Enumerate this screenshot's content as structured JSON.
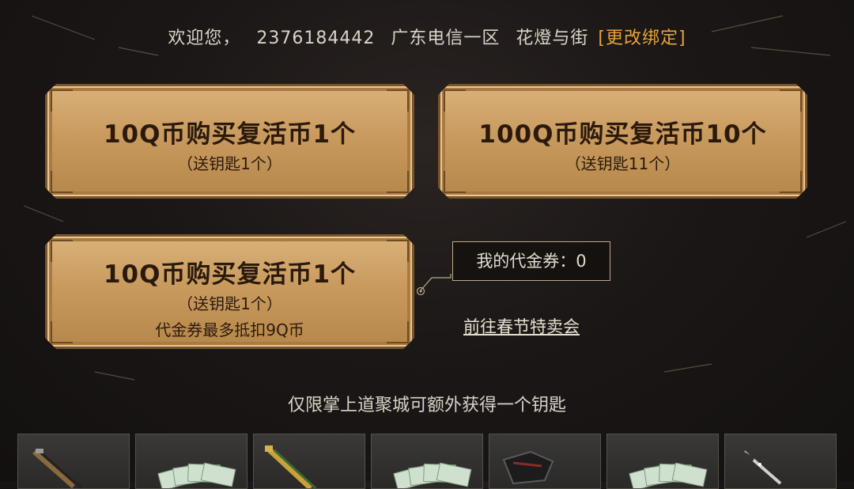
{
  "header": {
    "welcome_text": "欢迎您，",
    "account_id": "2376184442",
    "server": "广东电信一区",
    "nickname": "花燈与街",
    "change_binding_label": "[更改绑定]"
  },
  "offers": [
    {
      "title": "10Q币购买复活币1个",
      "subtitle": "（送钥匙1个）"
    },
    {
      "title": "100Q币购买复活币10个",
      "subtitle": "（送钥匙11个）"
    },
    {
      "title": "10Q币购买复活币1个",
      "subtitle": "（送钥匙1个）",
      "note": "代金券最多抵扣9Q币"
    }
  ],
  "voucher": {
    "label": "我的代金券：0"
  },
  "festival_link": "前往春节特卖会",
  "notice": "仅限掌上道聚城可额外获得一个钥匙",
  "reward_items": [
    {
      "icon": "rifle-icon"
    },
    {
      "icon": "banknotes-icon"
    },
    {
      "icon": "gold-rifle-icon"
    },
    {
      "icon": "banknotes-icon"
    },
    {
      "icon": "armor-icon"
    },
    {
      "icon": "banknotes-icon"
    },
    {
      "icon": "knife-icon"
    }
  ]
}
